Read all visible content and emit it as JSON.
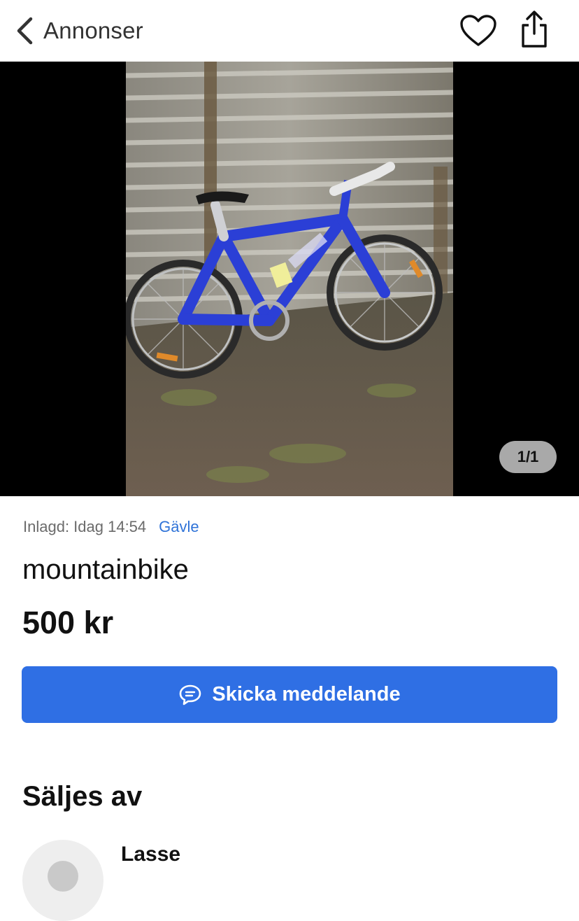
{
  "header": {
    "back_label": "Annonser",
    "icons": {
      "back": "chevron-left-icon",
      "favorite": "heart-icon",
      "share": "share-icon"
    }
  },
  "gallery": {
    "counter": "1/1",
    "photo_description_icon": "photo"
  },
  "listing": {
    "posted_label": "Inlagd: Idag 14:54",
    "location": "Gävle",
    "title": "mountainbike",
    "price": "500 kr"
  },
  "actions": {
    "message_label": "Skicka meddelande",
    "message_icon": "chat-bubble-icon"
  },
  "seller": {
    "heading": "Säljes av",
    "name": "Lasse"
  },
  "colors": {
    "accent": "#2f6fe4",
    "link": "#2f73d8",
    "counter_bg": "#a9a9a9"
  }
}
